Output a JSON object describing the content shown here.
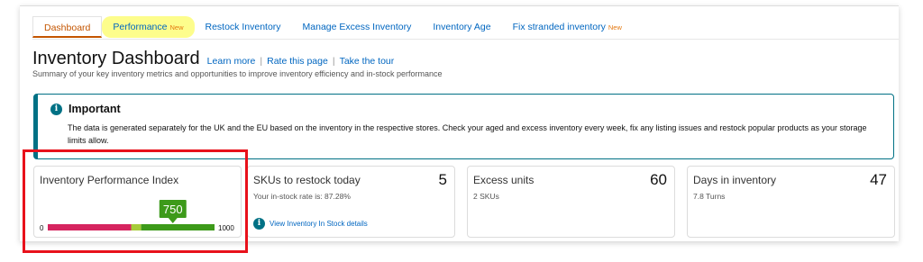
{
  "tabs": [
    {
      "label": "Dashboard"
    },
    {
      "label": "Performance",
      "badge": "New"
    },
    {
      "label": "Restock Inventory"
    },
    {
      "label": "Manage Excess Inventory"
    },
    {
      "label": "Inventory Age"
    },
    {
      "label": "Fix stranded inventory",
      "badge": "New"
    }
  ],
  "header": {
    "title": "Inventory Dashboard",
    "links": [
      "Learn more",
      "Rate this page",
      "Take the tour"
    ],
    "separator": "|",
    "subtitle": "Summary of your key inventory metrics and opportunities to improve inventory efficiency and in-stock performance"
  },
  "important": {
    "icon": "info-icon",
    "icon_glyph": "i",
    "title": "Important",
    "text": "The data is generated separately for the UK and the EU based on the inventory in the respective stores. Check your aged and excess inventory every week, fix any listing issues and restock popular products as your storage limits allow."
  },
  "cards": {
    "ipi": {
      "title": "Inventory Performance Index",
      "score": 750,
      "score_label": "750",
      "min": 0,
      "max": 1000,
      "min_label": "0",
      "max_label": "1000",
      "bands": [
        {
          "from": 0,
          "to": 500,
          "color": "#d6245f"
        },
        {
          "from": 500,
          "to": 560,
          "color": "#a6cc3a"
        },
        {
          "from": 560,
          "to": 1000,
          "color": "#3d9a1a"
        }
      ],
      "marker_color": "#3d9a1a"
    },
    "restock": {
      "title": "SKUs to restock today",
      "value": "5",
      "sub": "Your in-stock rate is: 87.28%",
      "link": "View Inventory In Stock details",
      "icon": "info-icon",
      "icon_glyph": "i"
    },
    "excess": {
      "title": "Excess units",
      "value": "60",
      "sub": "2 SKUs"
    },
    "days": {
      "title": "Days in inventory",
      "value": "47",
      "sub": "7.8 Turns"
    }
  },
  "colors": {
    "link": "#0066c0",
    "active_tab": "#c45500",
    "badge": "#e47911",
    "highlight": "#fdfd8c",
    "info": "#007185",
    "annotation": "#e8111b"
  }
}
